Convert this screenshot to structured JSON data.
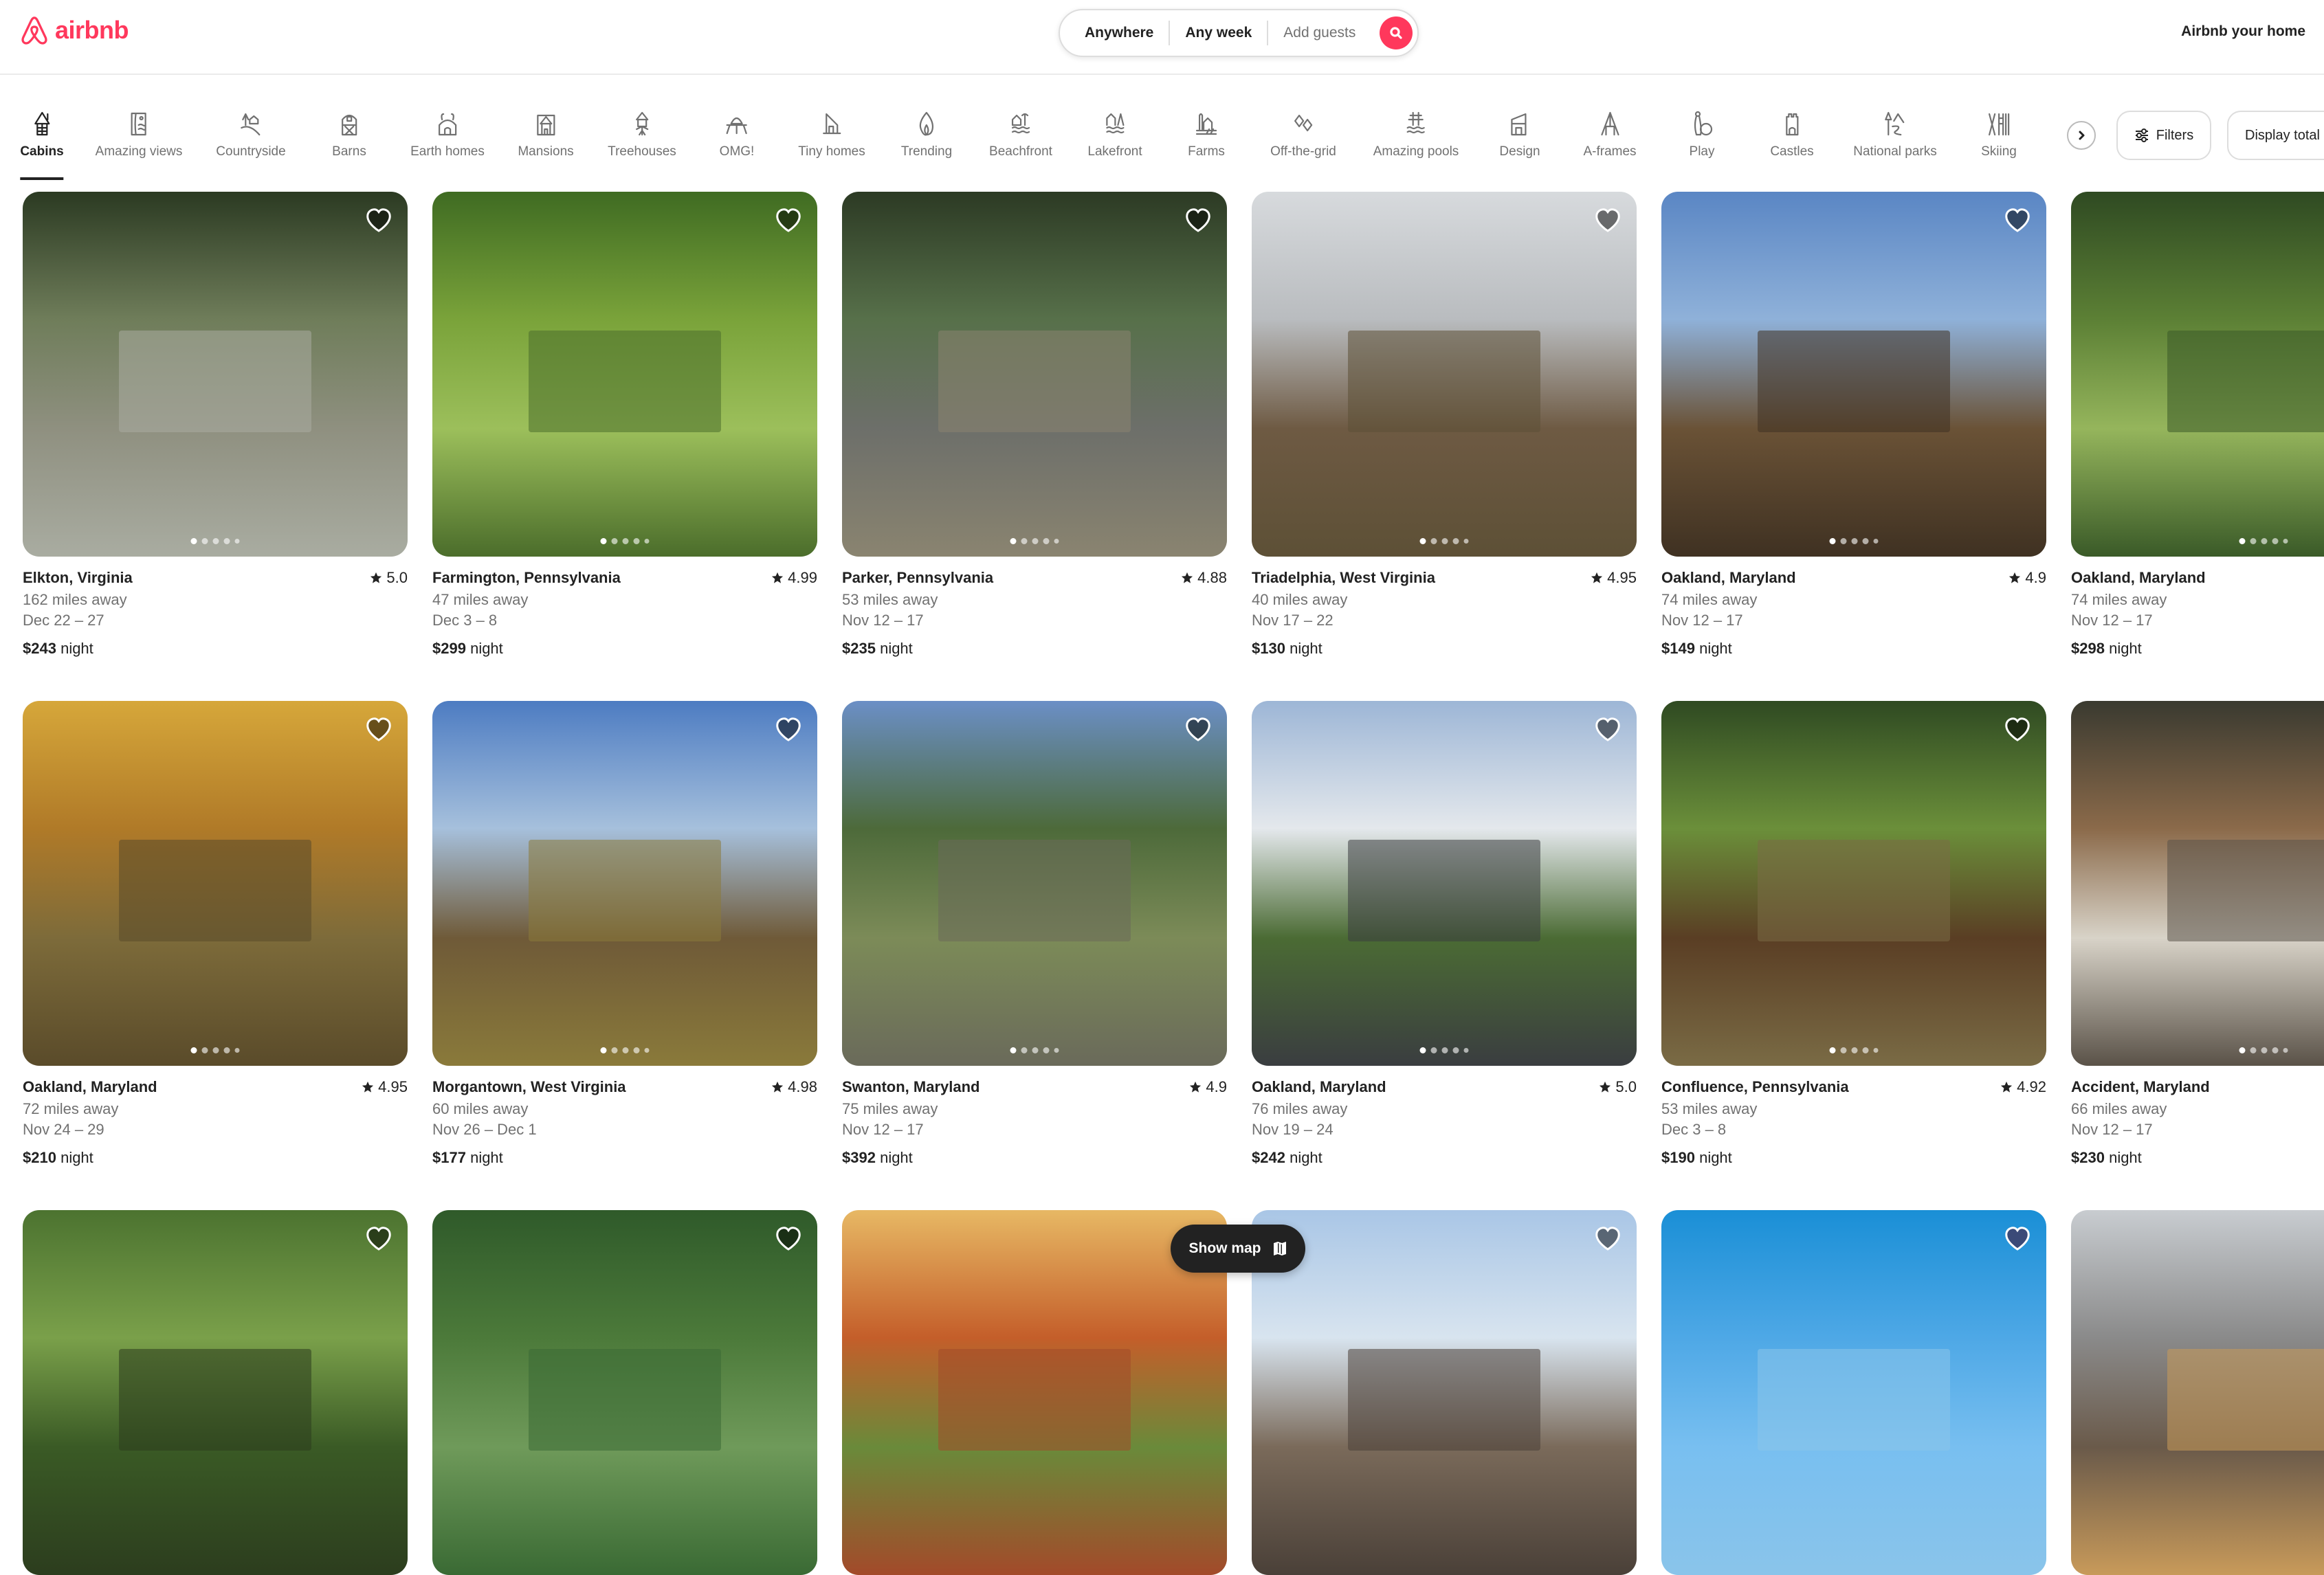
{
  "brand": {
    "name": "airbnb",
    "color": "#ff385c"
  },
  "search": {
    "where": "Anywhere",
    "when": "Any week",
    "guests_placeholder": "Add guests",
    "search_icon": "search-icon"
  },
  "header": {
    "host_link": "Airbnb your home"
  },
  "categories": [
    {
      "label": "Cabins",
      "icon": "cabin-icon",
      "active": true
    },
    {
      "label": "Amazing views",
      "icon": "amazing-views-icon"
    },
    {
      "label": "Countryside",
      "icon": "countryside-icon"
    },
    {
      "label": "Barns",
      "icon": "barn-icon"
    },
    {
      "label": "Earth homes",
      "icon": "earth-home-icon"
    },
    {
      "label": "Mansions",
      "icon": "mansion-icon"
    },
    {
      "label": "Treehouses",
      "icon": "treehouse-icon"
    },
    {
      "label": "OMG!",
      "icon": "ufo-icon"
    },
    {
      "label": "Tiny homes",
      "icon": "tiny-home-icon"
    },
    {
      "label": "Trending",
      "icon": "flame-icon"
    },
    {
      "label": "Beachfront",
      "icon": "beachfront-icon"
    },
    {
      "label": "Lakefront",
      "icon": "lakefront-icon"
    },
    {
      "label": "Farms",
      "icon": "farm-icon"
    },
    {
      "label": "Off-the-grid",
      "icon": "off-the-grid-icon"
    },
    {
      "label": "Amazing pools",
      "icon": "pool-icon"
    },
    {
      "label": "Design",
      "icon": "design-icon"
    },
    {
      "label": "A-frames",
      "icon": "a-frame-icon"
    },
    {
      "label": "Play",
      "icon": "bowling-icon"
    },
    {
      "label": "Castles",
      "icon": "castle-icon"
    },
    {
      "label": "National parks",
      "icon": "national-park-icon"
    },
    {
      "label": "Skiing",
      "icon": "skiing-icon"
    }
  ],
  "toolbar": {
    "next_icon": "chevron-right-icon",
    "filters_label": "Filters",
    "display_total_label": "Display total before taxes"
  },
  "listings": [
    {
      "location": "Elkton, Virginia",
      "rating": "5.0",
      "distance": "162 miles away",
      "dates": "Dec 22 – 27",
      "price": "$243",
      "price_unit": "night"
    },
    {
      "location": "Farmington, Pennsylvania",
      "rating": "4.99",
      "distance": "47 miles away",
      "dates": "Dec 3 – 8",
      "price": "$299",
      "price_unit": "night"
    },
    {
      "location": "Parker, Pennsylvania",
      "rating": "4.88",
      "distance": "53 miles away",
      "dates": "Nov 12 – 17",
      "price": "$235",
      "price_unit": "night"
    },
    {
      "location": "Triadelphia, West Virginia",
      "rating": "4.95",
      "distance": "40 miles away",
      "dates": "Nov 17 – 22",
      "price": "$130",
      "price_unit": "night"
    },
    {
      "location": "Oakland, Maryland",
      "rating": "4.9",
      "distance": "74 miles away",
      "dates": "Nov 12 – 17",
      "price": "$149",
      "price_unit": "night"
    },
    {
      "location": "Oakland, Maryland",
      "rating": "",
      "distance": "74 miles away",
      "dates": "Nov 12 – 17",
      "price": "$298",
      "price_unit": "night"
    },
    {
      "location": "Oakland, Maryland",
      "rating": "4.95",
      "distance": "72 miles away",
      "dates": "Nov 24 – 29",
      "price": "$210",
      "price_unit": "night"
    },
    {
      "location": "Morgantown, West Virginia",
      "rating": "4.98",
      "distance": "60 miles away",
      "dates": "Nov 26 – Dec 1",
      "price": "$177",
      "price_unit": "night"
    },
    {
      "location": "Swanton, Maryland",
      "rating": "4.9",
      "distance": "75 miles away",
      "dates": "Nov 12 – 17",
      "price": "$392",
      "price_unit": "night"
    },
    {
      "location": "Oakland, Maryland",
      "rating": "5.0",
      "distance": "76 miles away",
      "dates": "Nov 19 – 24",
      "price": "$242",
      "price_unit": "night"
    },
    {
      "location": "Confluence, Pennsylvania",
      "rating": "4.92",
      "distance": "53 miles away",
      "dates": "Dec 3 – 8",
      "price": "$190",
      "price_unit": "night"
    },
    {
      "location": "Accident, Maryland",
      "rating": "",
      "distance": "66 miles away",
      "dates": "Nov 12 – 17",
      "price": "$230",
      "price_unit": "night"
    },
    {
      "location": "",
      "rating": "",
      "distance": "",
      "dates": "",
      "price": "",
      "price_unit": ""
    },
    {
      "location": "",
      "rating": "",
      "distance": "",
      "dates": "",
      "price": "",
      "price_unit": ""
    },
    {
      "location": "",
      "rating": "",
      "distance": "",
      "dates": "",
      "price": "",
      "price_unit": ""
    },
    {
      "location": "",
      "rating": "",
      "distance": "",
      "dates": "",
      "price": "",
      "price_unit": ""
    },
    {
      "location": "",
      "rating": "",
      "distance": "",
      "dates": "",
      "price": "",
      "price_unit": ""
    },
    {
      "location": "",
      "rating": "",
      "distance": "",
      "dates": "",
      "price": "",
      "price_unit": ""
    }
  ],
  "show_map": {
    "label": "Show map",
    "icon": "map-icon"
  }
}
